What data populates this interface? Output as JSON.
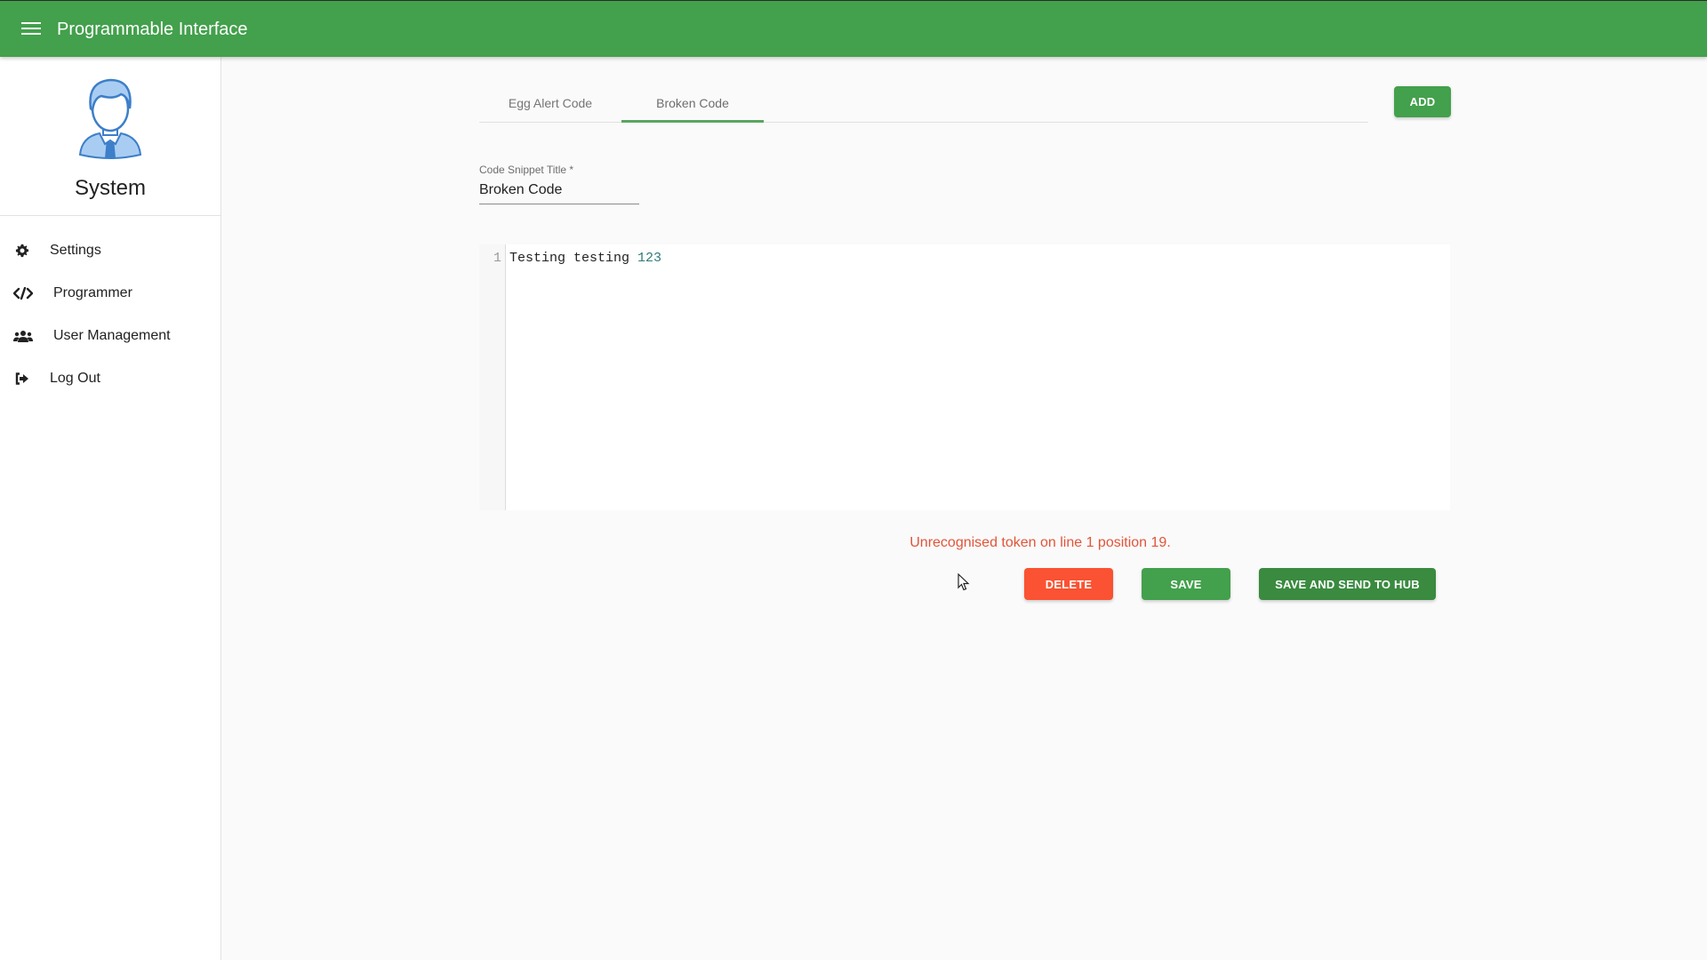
{
  "appbar": {
    "title": "Programmable Interface",
    "menu_icon": "hamburger-menu-icon",
    "color": "#43a04c"
  },
  "sidebar": {
    "user": {
      "avatar_icon": "user-avatar-icon",
      "name": "System"
    },
    "items": [
      {
        "label": "Settings",
        "icon": "gear-icon"
      },
      {
        "label": "Programmer",
        "icon": "code-icon"
      },
      {
        "label": "User Management",
        "icon": "users-icon"
      },
      {
        "label": "Log Out",
        "icon": "sign-out-icon"
      }
    ]
  },
  "main": {
    "tabs": [
      {
        "label": "Egg Alert Code",
        "active": false
      },
      {
        "label": "Broken Code",
        "active": true
      }
    ],
    "add_button": "ADD",
    "title_field": {
      "label": "Code Snippet Title *",
      "value": "Broken Code"
    },
    "editor": {
      "lines": [
        {
          "number": "1",
          "text": "Testing testing ",
          "number_token": "123"
        }
      ]
    },
    "error_message": "Unrecognised token on line 1 position 19.",
    "buttons": {
      "delete": "DELETE",
      "save": "SAVE",
      "save_and_send": "SAVE AND SEND TO HUB"
    },
    "colors": {
      "primary": "#43a04c",
      "danger": "#fa5232",
      "dark_primary": "#3a8a40",
      "error_text": "#e0553a"
    }
  }
}
